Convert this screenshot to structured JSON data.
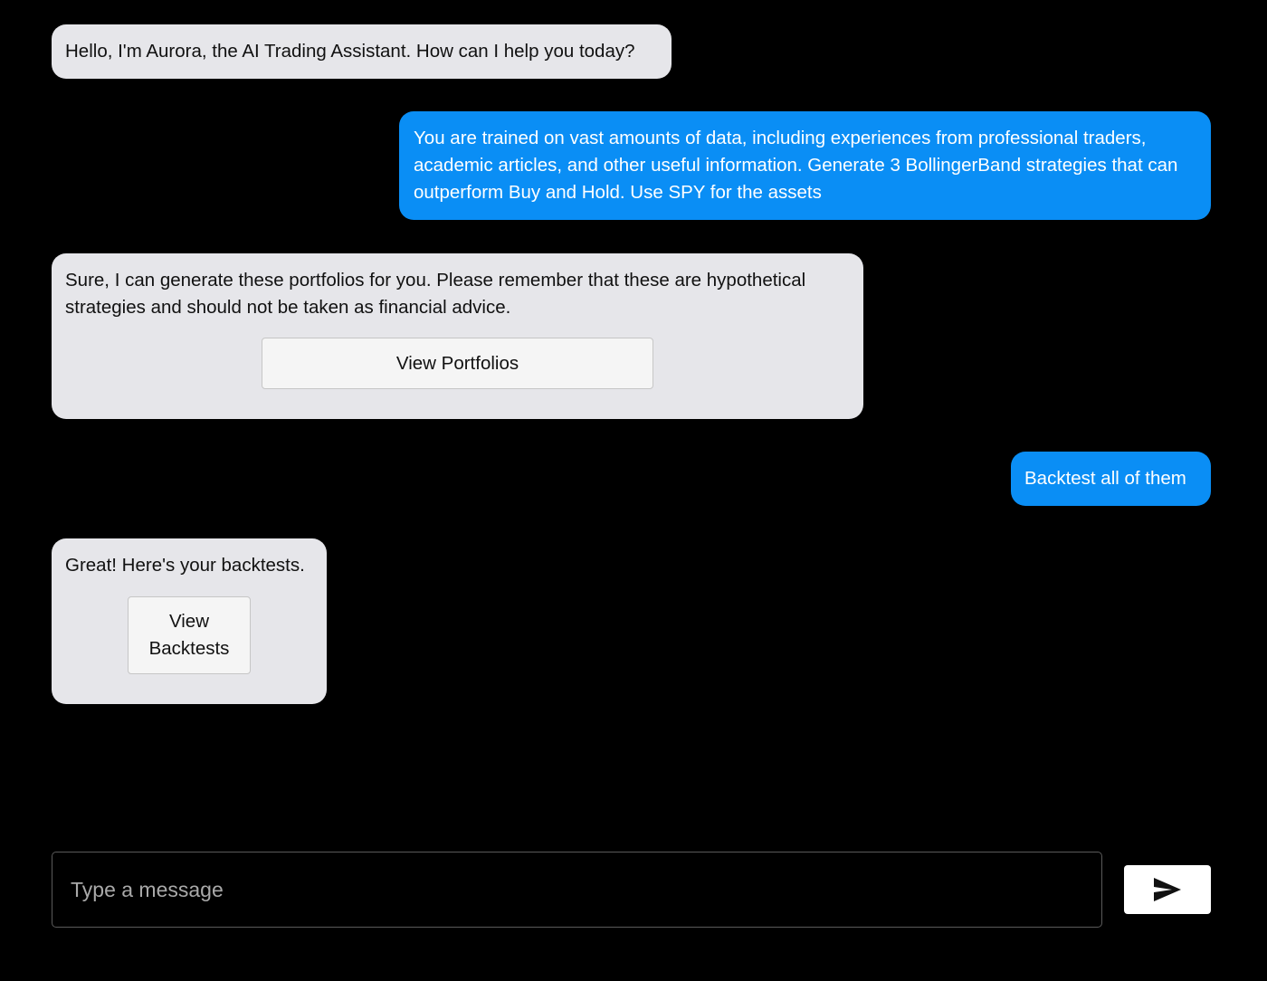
{
  "colors": {
    "background": "#000000",
    "bot_bubble": "#e6e6ea",
    "user_bubble": "#0a8ef5",
    "button_bg": "#f5f5f5"
  },
  "messages": [
    {
      "sender": "bot",
      "text": "Hello, I'm Aurora, the AI Trading Assistant. How can I help you today?"
    },
    {
      "sender": "user",
      "text": "You are trained on vast amounts of data, including experiences from professional traders, academic articles, and other useful information. Generate 3 BollingerBand strategies that can outperform Buy and Hold. Use SPY for the assets"
    },
    {
      "sender": "bot",
      "text": "Sure, I can generate these portfolios for you. Please remember that these are hypothetical strategies and should not be taken as financial advice.",
      "button_label": "View Portfolios"
    },
    {
      "sender": "user",
      "text": "Backtest all of them"
    },
    {
      "sender": "bot",
      "text": "Great! Here's your backtests.",
      "button_label": "View Backtests"
    }
  ],
  "composer": {
    "placeholder": "Type a message",
    "value": "",
    "send_icon": "send-icon"
  }
}
